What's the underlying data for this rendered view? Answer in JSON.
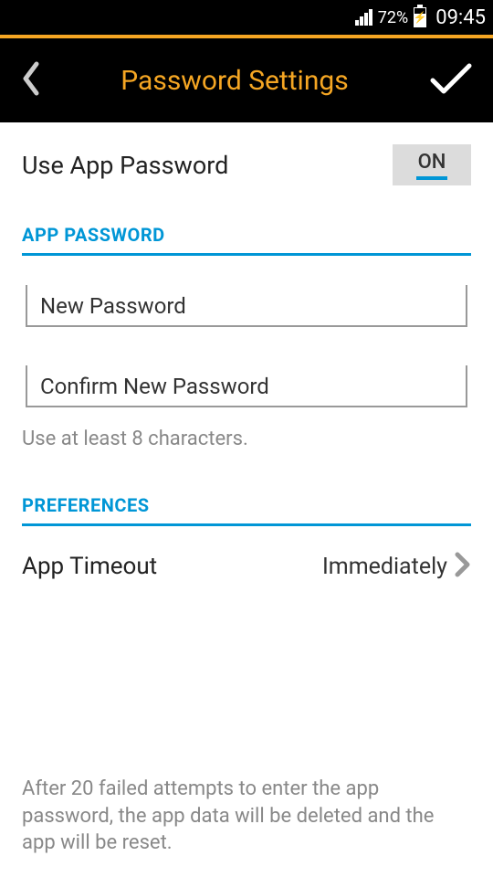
{
  "status_bar": {
    "battery_percent": "72%",
    "time": "09:45"
  },
  "header": {
    "title": "Password Settings"
  },
  "toggle": {
    "label": "Use App Password",
    "state": "ON"
  },
  "sections": {
    "app_password": {
      "header": "APP PASSWORD",
      "new_password_placeholder": "New Password",
      "confirm_password_placeholder": "Confirm New Password",
      "hint": "Use at least 8 characters."
    },
    "preferences": {
      "header": "PREFERENCES",
      "timeout_label": "App Timeout",
      "timeout_value": "Immediately"
    }
  },
  "footer": {
    "text": "After 20 failed attempts to enter the app password, the app data will be deleted and the app will be reset."
  }
}
